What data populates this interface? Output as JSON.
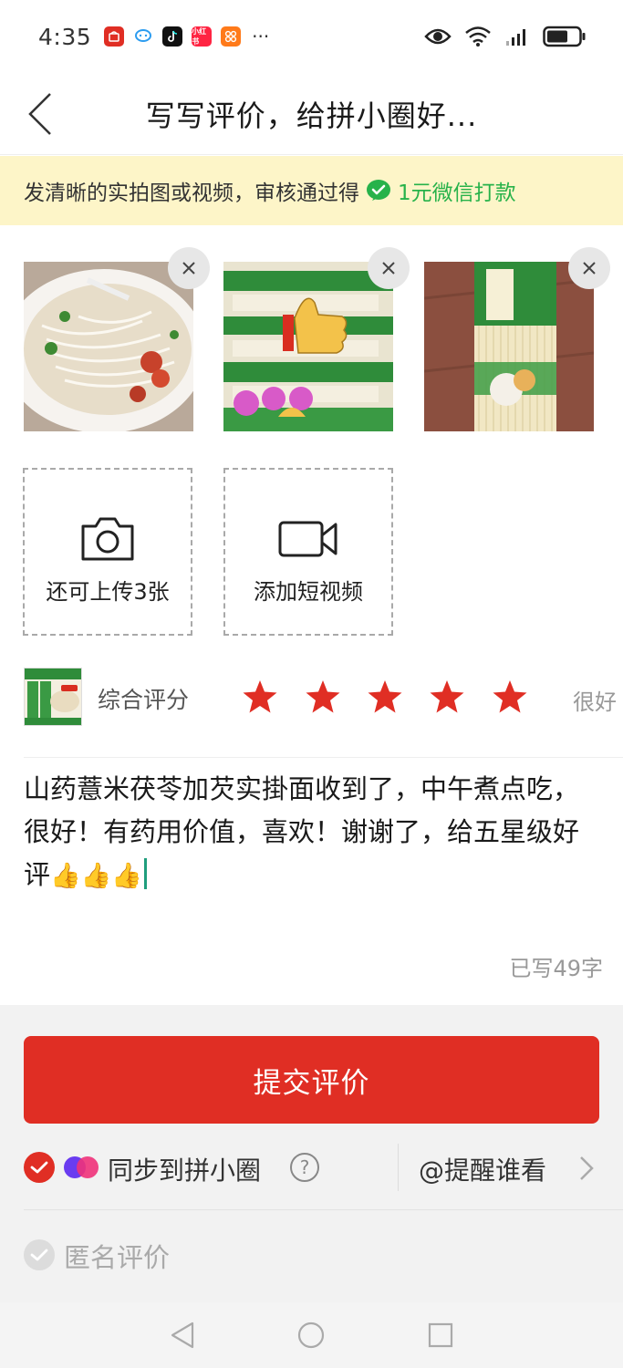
{
  "status_bar": {
    "time": "4:35",
    "app_icons": [
      "pinduoduo-icon",
      "chat-bubble-icon",
      "tiktok-icon",
      "xiaohongshu-icon",
      "app-grid-icon"
    ],
    "more_indicator": "···"
  },
  "header": {
    "title": "写写评价，给拼小圈好..."
  },
  "banner": {
    "text": "发清晰的实拍图或视频，审核通过得",
    "reward": "1元微信打款",
    "reward_color": "#27b24a",
    "background": "#fdf5c8"
  },
  "photos": [
    {
      "icon": "noodle-soup-photo"
    },
    {
      "icon": "noodle-package-thumbsup-photo"
    },
    {
      "icon": "noodle-bundle-photo"
    }
  ],
  "upload": {
    "photo_label": "还可上传3张",
    "video_label": "添加短视频"
  },
  "rating": {
    "label": "综合评分",
    "stars": 5,
    "max_stars": 5,
    "text": "很好",
    "star_color": "#e02e24"
  },
  "review": {
    "text": "山药薏米茯苓加芡实掛面收到了，中午煮点吃，很好！有药用价值，喜欢！谢谢了，给五星级好评",
    "emoji": "👍👍👍",
    "word_count": "已写49字"
  },
  "submit": {
    "label": "提交评价",
    "color": "#e02e24"
  },
  "sync": {
    "label": "同步到拼小圈",
    "checked": true,
    "help": "?",
    "remind_label": "@提醒谁看"
  },
  "anonymous": {
    "label": "匿名评价",
    "checked": false
  }
}
